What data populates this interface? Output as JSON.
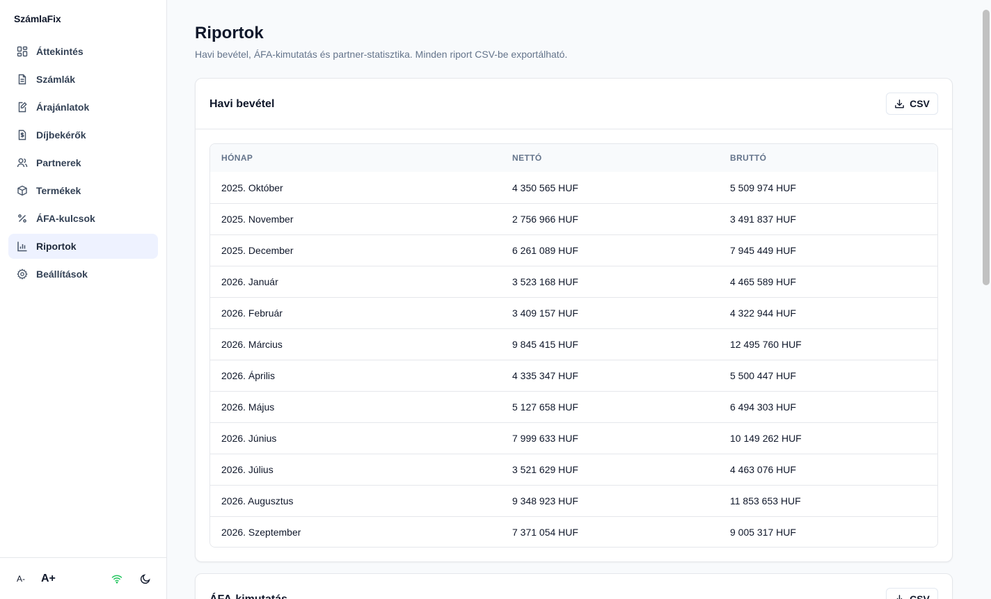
{
  "app": {
    "brand": "SzámlaFix"
  },
  "sidebar": {
    "items": [
      {
        "label": "Áttekintés",
        "icon": "dashboard-icon"
      },
      {
        "label": "Számlák",
        "icon": "document-icon"
      },
      {
        "label": "Árajánlatok",
        "icon": "quote-edit-icon"
      },
      {
        "label": "Díjbekérők",
        "icon": "dollar-receipt-icon"
      },
      {
        "label": "Partnerek",
        "icon": "users-icon"
      },
      {
        "label": "Termékek",
        "icon": "box-icon"
      },
      {
        "label": "ÁFA-kulcsok",
        "icon": "percent-icon"
      },
      {
        "label": "Riportok",
        "icon": "bar-chart-icon",
        "active": true
      },
      {
        "label": "Beállítások",
        "icon": "gear-icon"
      }
    ],
    "footer": {
      "font_decrease": "A-",
      "font_increase": "A+",
      "connection_color": "#22c55e"
    }
  },
  "page": {
    "title": "Riportok",
    "subtitle": "Havi bevétel, ÁFA-kimutatás és partner-statisztika. Minden riport CSV-be exportálható."
  },
  "monthly_revenue": {
    "title": "Havi bevétel",
    "export_label": "CSV",
    "columns": [
      "HÓNAP",
      "NETTÓ",
      "BRUTTÓ"
    ],
    "rows": [
      [
        "2025. Október",
        "4 350 565 HUF",
        "5 509 974 HUF"
      ],
      [
        "2025. November",
        "2 756 966 HUF",
        "3 491 837 HUF"
      ],
      [
        "2025. December",
        "6 261 089 HUF",
        "7 945 449 HUF"
      ],
      [
        "2026. Január",
        "3 523 168 HUF",
        "4 465 589 HUF"
      ],
      [
        "2026. Február",
        "3 409 157 HUF",
        "4 322 944 HUF"
      ],
      [
        "2026. Március",
        "9 845 415 HUF",
        "12 495 760 HUF"
      ],
      [
        "2026. Április",
        "4 335 347 HUF",
        "5 500 447 HUF"
      ],
      [
        "2026. Május",
        "5 127 658 HUF",
        "6 494 303 HUF"
      ],
      [
        "2026. Június",
        "7 999 633 HUF",
        "10 149 262 HUF"
      ],
      [
        "2026. Július",
        "3 521 629 HUF",
        "4 463 076 HUF"
      ],
      [
        "2026. Augusztus",
        "9 348 923 HUF",
        "11 853 653 HUF"
      ],
      [
        "2026. Szeptember",
        "7 371 054 HUF",
        "9 005 317 HUF"
      ]
    ]
  },
  "vat_report": {
    "title": "ÁFA-kimutatás",
    "export_label": "CSV"
  }
}
